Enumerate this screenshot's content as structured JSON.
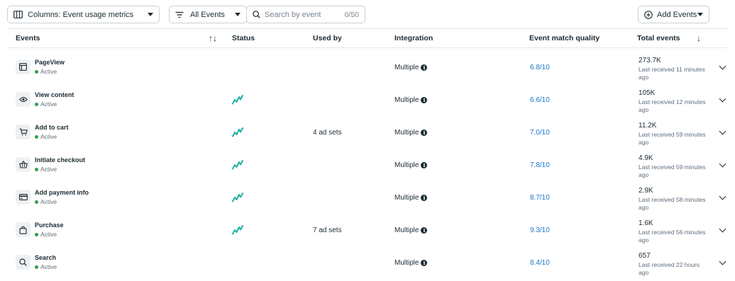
{
  "toolbar": {
    "columns_label": "Columns: Event usage metrics",
    "filter_label": "All Events",
    "search_placeholder": "Search by event",
    "search_count": "0/50",
    "add_events_label": "Add Events"
  },
  "table": {
    "headers": {
      "events": "Events",
      "status": "Status",
      "used_by": "Used by",
      "integration": "Integration",
      "event_match_quality": "Event match quality",
      "total_events": "Total events"
    },
    "rows": [
      {
        "name": "PageView",
        "status": "Active",
        "icon": "browser-window-icon",
        "has_spark": false,
        "used_by": "",
        "integration": "Multiple",
        "emq": "6.8/10",
        "total": "273.7K",
        "last_received": "Last received 11 minutes ago"
      },
      {
        "name": "View content",
        "status": "Active",
        "icon": "eye-icon",
        "has_spark": true,
        "used_by": "",
        "integration": "Multiple",
        "emq": "6.6/10",
        "total": "105K",
        "last_received": "Last received 12 minutes ago"
      },
      {
        "name": "Add to cart",
        "status": "Active",
        "icon": "shopping-cart-icon",
        "has_spark": true,
        "used_by": "4 ad sets",
        "integration": "Multiple",
        "emq": "7.0/10",
        "total": "11.2K",
        "last_received": "Last received 59 minutes ago"
      },
      {
        "name": "Initiate checkout",
        "status": "Active",
        "icon": "shopping-basket-icon",
        "has_spark": true,
        "used_by": "",
        "integration": "Multiple",
        "emq": "7.8/10",
        "total": "4.9K",
        "last_received": "Last received 59 minutes ago"
      },
      {
        "name": "Add payment info",
        "status": "Active",
        "icon": "credit-card-icon",
        "has_spark": true,
        "used_by": "",
        "integration": "Multiple",
        "emq": "8.7/10",
        "total": "2.9K",
        "last_received": "Last received 58 minutes ago"
      },
      {
        "name": "Purchase",
        "status": "Active",
        "icon": "shopping-bag-icon",
        "has_spark": true,
        "used_by": "7 ad sets",
        "integration": "Multiple",
        "emq": "9.3/10",
        "total": "1.6K",
        "last_received": "Last received 56 minutes ago"
      },
      {
        "name": "Search",
        "status": "Active",
        "icon": "magnifier-icon",
        "has_spark": false,
        "used_by": "",
        "integration": "Multiple",
        "emq": "8.4/10",
        "total": "657",
        "last_received": "Last received 22 hours ago"
      }
    ]
  },
  "colors": {
    "accent_link": "#1a77c9",
    "active_dot": "#2aa24a",
    "sparkline": "#1fb0a6"
  }
}
